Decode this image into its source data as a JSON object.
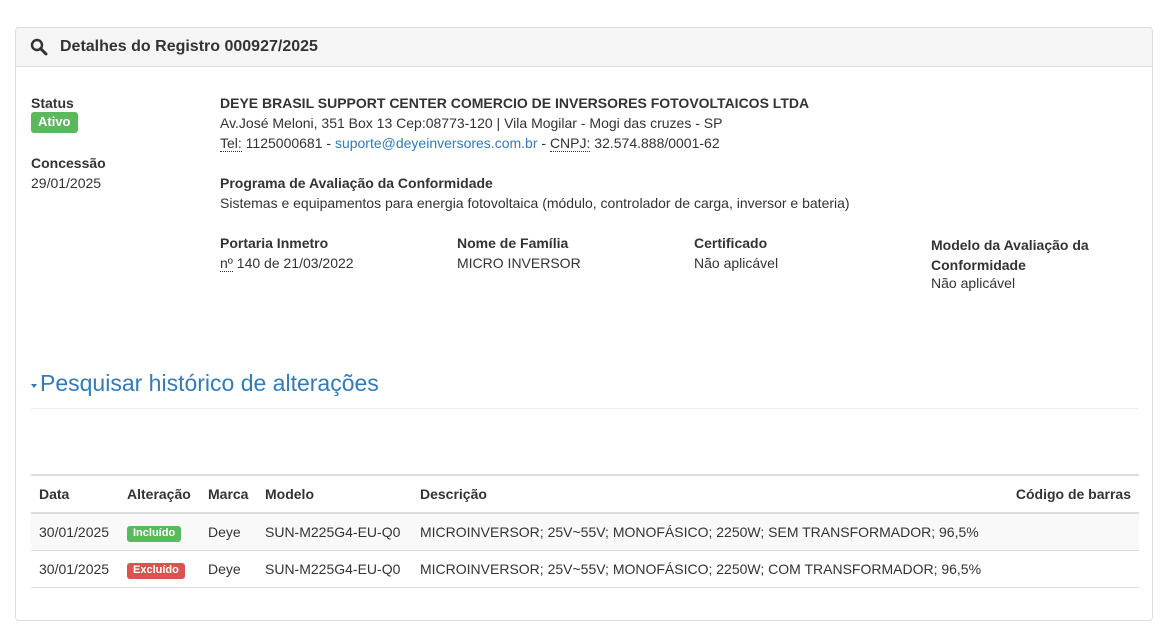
{
  "panel": {
    "title": "Detalhes do Registro 000927/2025",
    "icon": "search-icon"
  },
  "left": {
    "status_label": "Status",
    "status_value": "Ativo",
    "concessao_label": "Concessão",
    "concessao_value": "29/01/2025"
  },
  "company": {
    "name": "DEYE BRASIL SUPPORT CENTER COMERCIO DE INVERSORES FOTOVOLTAICOS LTDA",
    "address": "Av.José Meloni, 351 Box 13 Cep:08773-120 | Vila Mogilar - Mogi das cruzes - SP",
    "tel_abbr": "Tel:",
    "tel_value": " 1125000681 - ",
    "email": "suporte@deyeinversores.com.br",
    "sep": " - ",
    "cnpj_abbr": "CNPJ:",
    "cnpj_value": " 32.574.888/0001-62"
  },
  "program": {
    "label": "Programa de Avaliação da Conformidade",
    "value": "Sistemas e equipamentos para energia fotovoltaica (módulo, controlador de carga, inversor e bateria)"
  },
  "fields": {
    "portaria_label": "Portaria Inmetro",
    "portaria_abbr": "nº",
    "portaria_value": " 140 de 21/03/2022",
    "familia_label": "Nome de Família",
    "familia_value": "MICRO INVERSOR",
    "certificado_label": "Certificado",
    "certificado_value": "Não aplicável",
    "modelo_label": "Modelo da Avaliação da Conformidade",
    "modelo_value": "Não aplicável"
  },
  "history": {
    "title": "Pesquisar histórico de alterações",
    "columns": [
      "Data",
      "Alteração",
      "Marca",
      "Modelo",
      "Descrição",
      "Código de barras"
    ],
    "rows": [
      {
        "data": "30/01/2025",
        "alteracao": "Incluído",
        "marca": "Deye",
        "modelo": "SUN-M225G4-EU-Q0",
        "descricao": "MICROINVERSOR; 25V~55V; MONOFÁSICO; 2250W; SEM TRANSFORMADOR; 96,5%",
        "codigo": ""
      },
      {
        "data": "30/01/2025",
        "alteracao": "Excluído",
        "marca": "Deye",
        "modelo": "SUN-M225G4-EU-Q0",
        "descricao": "MICROINVERSOR; 25V~55V; MONOFÁSICO; 2250W; COM TRANSFORMADOR; 96,5%",
        "codigo": ""
      }
    ]
  },
  "colors": {
    "success": "#5cb85c",
    "danger": "#d9534f",
    "link": "#337ab7"
  }
}
